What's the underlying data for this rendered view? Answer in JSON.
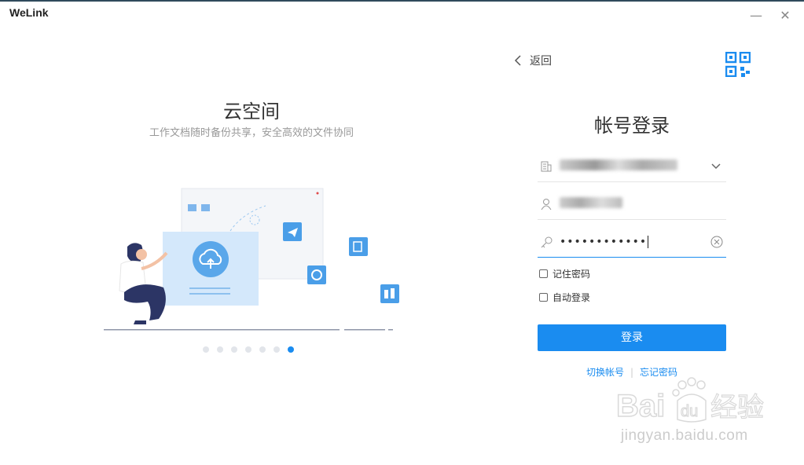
{
  "window": {
    "title": "WeLink",
    "minimize_glyph": "—",
    "close_glyph": "✕"
  },
  "showcase": {
    "title": "云空间",
    "subtitle": "工作文档随时备份共享，安全高效的文件协同",
    "carousel_total": 7,
    "carousel_active_index": 7
  },
  "login": {
    "back_label": "返回",
    "title": "帐号登录",
    "password_mask": "••••••••••••",
    "remember_label": "记住密码",
    "remember_checked": false,
    "auto_login_label": "自动登录",
    "auto_login_checked": false,
    "submit_label": "登录",
    "switch_account_label": "切换帐号",
    "forgot_password_label": "忘记密码"
  },
  "watermark": {
    "brand": "Bai du 经验",
    "url": "jingyan.baidu.com"
  },
  "colors": {
    "accent": "#1a8cf0",
    "illustration_light": "#d4e8fb",
    "illustration_mid": "#5aa7ea"
  }
}
